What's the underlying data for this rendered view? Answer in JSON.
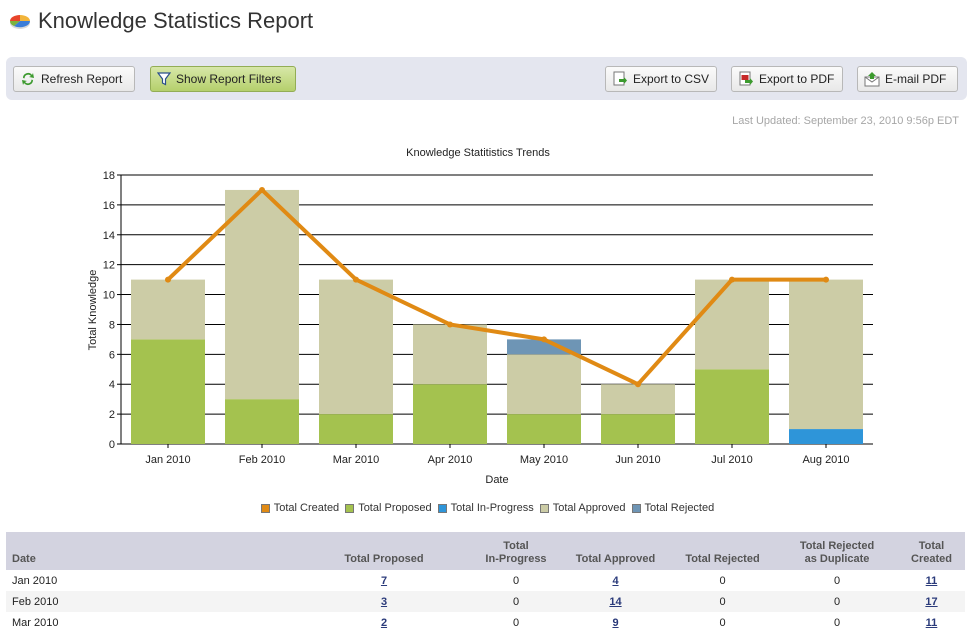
{
  "page": {
    "title": "Knowledge Statistics Report",
    "last_updated": "Last Updated: September 23, 2010 9:56p EDT"
  },
  "toolbar": {
    "refresh_label": "Refresh Report",
    "filters_label": "Show Report Filters",
    "csv_label": "Export to CSV",
    "pdf_label": "Export to PDF",
    "email_label": "E-mail PDF"
  },
  "colors": {
    "created": "#e08a14",
    "proposed": "#a4c24f",
    "in_progress": "#2e95d9",
    "approved": "#cccca6",
    "rejected": "#6e95b5"
  },
  "chart_data": {
    "type": "bar",
    "title": "Knowledge Statitistics Trends",
    "xlabel": "Date",
    "ylabel": "Total Knowledge",
    "ylim": [
      0,
      18
    ],
    "yticks": [
      "0",
      "2",
      "4",
      "6",
      "8",
      "10",
      "12",
      "14",
      "16",
      "18"
    ],
    "categories": [
      "Jan 2010",
      "Feb 2010",
      "Mar 2010",
      "Apr 2010",
      "May 2010",
      "Jun 2010",
      "Jul 2010",
      "Aug 2010"
    ],
    "grid": true,
    "legend_position": "bottom-center",
    "series": [
      {
        "name": "Total Created",
        "kind": "line",
        "values": [
          11,
          17,
          11,
          8,
          7,
          4,
          11,
          11
        ]
      },
      {
        "name": "Total Proposed",
        "kind": "stacked-bar",
        "values": [
          7,
          3,
          2,
          4,
          2,
          2,
          5,
          0
        ]
      },
      {
        "name": "Total In-Progress",
        "kind": "stacked-bar",
        "values": [
          0,
          0,
          0,
          0,
          0,
          0,
          0,
          1
        ]
      },
      {
        "name": "Total Approved",
        "kind": "stacked-bar",
        "values": [
          4,
          14,
          9,
          4,
          4,
          2,
          6,
          10
        ]
      },
      {
        "name": "Total Rejected",
        "kind": "stacked-bar",
        "values": [
          0,
          0,
          0,
          0,
          1,
          0,
          0,
          0
        ]
      }
    ]
  },
  "table": {
    "headers": {
      "date": "Date",
      "proposed": "Total Proposed",
      "in_progress_1": "Total",
      "in_progress_2": "In-Progress",
      "approved": "Total Approved",
      "rejected": "Total Rejected",
      "dup_1": "Total Rejected",
      "dup_2": "as Duplicate",
      "created": "Total Created"
    },
    "rows": [
      {
        "date": "Jan 2010",
        "proposed": "7",
        "in_progress": "0",
        "approved": "4",
        "rejected": "0",
        "duplicate": "0",
        "created": "11"
      },
      {
        "date": "Feb 2010",
        "proposed": "3",
        "in_progress": "0",
        "approved": "14",
        "rejected": "0",
        "duplicate": "0",
        "created": "17"
      },
      {
        "date": "Mar 2010",
        "proposed": "2",
        "in_progress": "0",
        "approved": "9",
        "rejected": "0",
        "duplicate": "0",
        "created": "11"
      }
    ]
  }
}
